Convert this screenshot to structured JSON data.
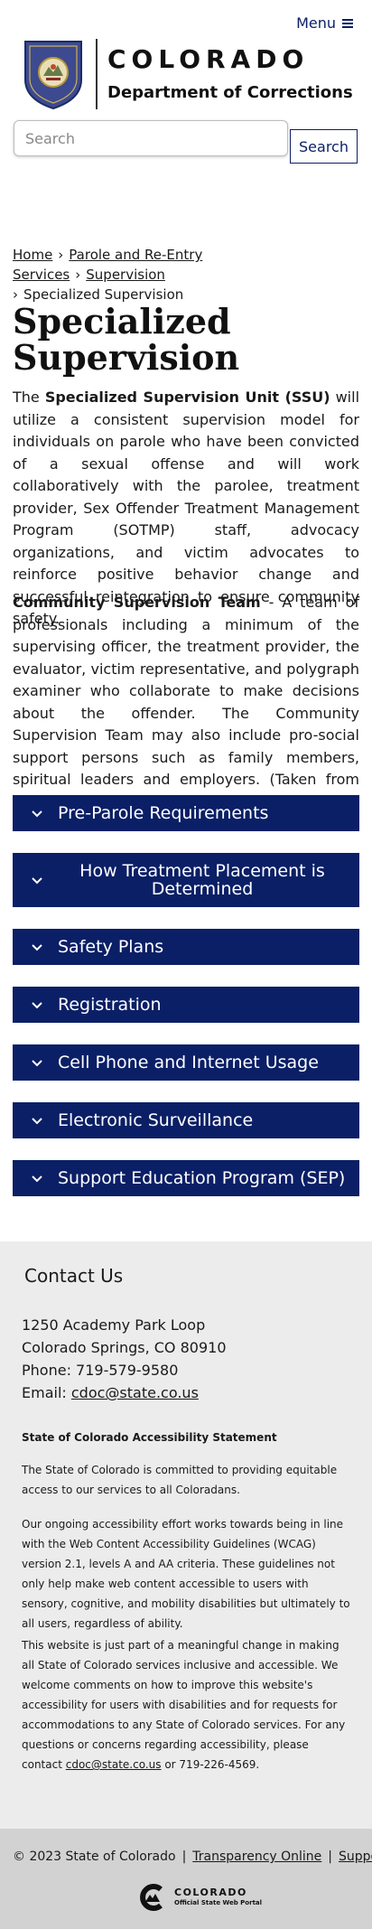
{
  "header": {
    "menu_label": "Menu",
    "brand_title": "COLORADO",
    "brand_subtitle": "Department of Corrections",
    "seal_text": "DEPARTMENT OF CORRECTIONS COLORADO"
  },
  "search": {
    "placeholder": "Search",
    "button_label": "Search"
  },
  "breadcrumb": {
    "items": [
      "Home",
      "Parole and Re-Entry Services",
      "Supervision"
    ],
    "current": "Specialized Supervision"
  },
  "page": {
    "title": "Specialized Supervision",
    "intro": {
      "pre": "The ",
      "bold": "Specialized Supervision Unit (SSU)",
      "post": " will utilize a consistent supervision model for individuals on parole who have been convicted of a sexual offense and will work collaboratively with the parolee, treatment provider, Sex Offender Treatment Management Program (SOTMP) staff, advocacy organizations, and victim advocates to reinforce positive behavior change and successful reintegration to ensure community safety."
    },
    "team": {
      "bold": "Community Supervision Team",
      "post": " - A team of professionals including a minimum of the supervising officer, the treatment provider, the evaluator, victim representative, and polygraph examiner who collaborate to make decisions about the offender. The Community Supervision Team may also include pro-social support persons such as family members, spiritual leaders and employers. (Taken from Sex Offender Management Board (SOMB) handbook)"
    }
  },
  "accordions": [
    {
      "label": "Pre-Parole Requirements"
    },
    {
      "label": "How Treatment Placement is Determined"
    },
    {
      "label": "Safety Plans"
    },
    {
      "label": "Registration"
    },
    {
      "label": "Cell Phone and Internet Usage"
    },
    {
      "label": "Electronic Surveillance"
    },
    {
      "label": "Support Education Program (SEP)"
    }
  ],
  "contact": {
    "heading": "Contact Us",
    "address1": "1250 Academy Park Loop",
    "address2": "Colorado Springs, CO 80910",
    "phone": "Phone: 719-579-9580",
    "email_label": "Email: ",
    "email": "cdoc@state.co.us"
  },
  "accessibility": {
    "title": "State of Colorado Accessibility Statement",
    "p1": "The State of Colorado is committed to providing equitable access to our services to all Coloradans.",
    "p2": "Our ongoing accessibility effort works towards being in line with the Web Content Accessibility Guidelines (WCAG) version 2.1, levels A and AA criteria. These guidelines not only help make web content accessible to users with sensory, cognitive, and mobility disabilities but ultimately to all users, regardless of ability.",
    "p3_pre": "This website is just part of a meaningful change in making all State of Colorado services inclusive and accessible. We welcome comments on how to improve this website's accessibility for users with disabilities and for requests for accommodations to any State of Colorado services. For any questions or concerns regarding accessibility, please contact ",
    "p3_email": "cdoc@state.co.us",
    "p3_post": " or 719-226-4569."
  },
  "footer": {
    "copyright": "© 2023 State of Colorado",
    "transparency": "Transparency Online",
    "support": "Support",
    "portal_name": "COLORADO",
    "portal_sub": "Official State Web Portal"
  },
  "colors": {
    "primary": "#0b1f66",
    "footer_bg": "#d2d2d2",
    "contact_bg": "#ececec"
  },
  "icons": [
    "menu-icon",
    "seal-logo",
    "chevron-down-icon",
    "colorado-portal-logo"
  ]
}
